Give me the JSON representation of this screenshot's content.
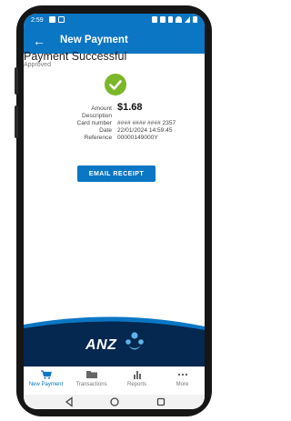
{
  "status_bar": {
    "time": "2:59"
  },
  "app_bar": {
    "title": "New Payment"
  },
  "result": {
    "title": "Payment Successful",
    "subtitle": "Approved"
  },
  "details": {
    "amount_label": "Amount",
    "amount_value": "$1.68",
    "description_label": "Description",
    "description_value": "",
    "card_label": "Card number",
    "card_value": "#### #### #### 2357",
    "date_label": "Date",
    "date_value": "22/01/2024 14:59:45",
    "reference_label": "Reference",
    "reference_value": "00000149000Y"
  },
  "actions": {
    "email_receipt": "EMAIL RECEIPT"
  },
  "brand": {
    "name": "ANZ"
  },
  "bottom_nav": {
    "items": [
      {
        "label": "New Payment",
        "icon": "cart-icon",
        "active": true
      },
      {
        "label": "Transactions",
        "icon": "folder-icon",
        "active": false
      },
      {
        "label": "Reports",
        "icon": "bar-chart-icon",
        "active": false
      },
      {
        "label": "More",
        "icon": "more-dots-icon",
        "active": false
      }
    ]
  },
  "colors": {
    "primary": "#0b76c4",
    "success": "#7ab82a",
    "navy": "#04284f"
  }
}
